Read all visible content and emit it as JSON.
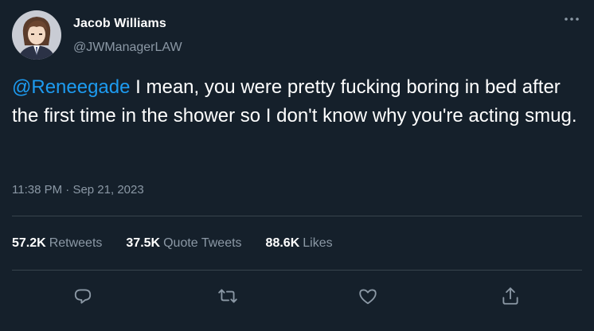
{
  "author": {
    "name": "Jacob Williams",
    "handle": "@JWManagerLAW"
  },
  "tweet": {
    "mention": "@Reneegade",
    "body": " I mean, you were pretty fucking boring in bed after the first time in the shower so I don't know why you're acting smug.",
    "time": "11:38 PM",
    "separator": " · ",
    "date": "Sep 21, 2023"
  },
  "stats": {
    "retweets_count": "57.2K",
    "retweets_label": "Retweets",
    "quotes_count": "37.5K",
    "quotes_label": "Quote Tweets",
    "likes_count": "88.6K",
    "likes_label": "Likes"
  },
  "icons": {
    "more": "more-horizontal-icon",
    "reply": "reply-icon",
    "retweet": "retweet-icon",
    "like": "heart-icon",
    "share": "share-icon"
  },
  "colors": {
    "background": "#15202b",
    "accent": "#1d9bf0",
    "secondary_text": "#8b98a5",
    "divider": "#38444d"
  }
}
